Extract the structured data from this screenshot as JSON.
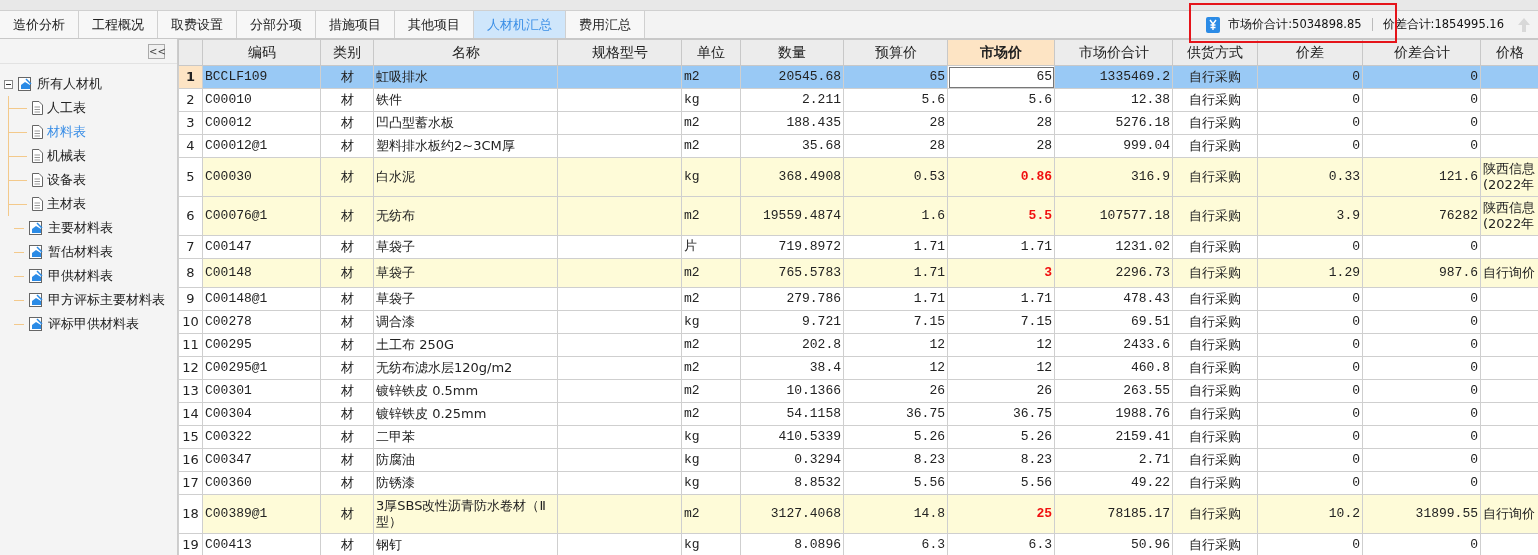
{
  "tabs": [
    {
      "label": "造价分析",
      "selected": false
    },
    {
      "label": "工程概况",
      "selected": false
    },
    {
      "label": "取费设置",
      "selected": false
    },
    {
      "label": "分部分项",
      "selected": false
    },
    {
      "label": "措施项目",
      "selected": false
    },
    {
      "label": "其他项目",
      "selected": false
    },
    {
      "label": "人材机汇总",
      "selected": true
    },
    {
      "label": "费用汇总",
      "selected": false
    }
  ],
  "summary": {
    "market_total": "市场价合计:5034898.85",
    "diff_total": "价差合计:1854995.16"
  },
  "sidebar": {
    "collapse_label": "<<",
    "items": [
      {
        "label": "所有人材机",
        "kind": "group",
        "expanded": true,
        "selected": false,
        "children": [
          {
            "label": "人工表",
            "kind": "sheet",
            "selected": false
          },
          {
            "label": "材料表",
            "kind": "sheet",
            "selected": true
          },
          {
            "label": "机械表",
            "kind": "sheet",
            "selected": false
          },
          {
            "label": "设备表",
            "kind": "sheet",
            "selected": false
          },
          {
            "label": "主材表",
            "kind": "sheet",
            "selected": false
          }
        ]
      },
      {
        "label": "主要材料表",
        "kind": "report",
        "selected": false
      },
      {
        "label": "暂估材料表",
        "kind": "report",
        "selected": false
      },
      {
        "label": "甲供材料表",
        "kind": "report",
        "selected": false
      },
      {
        "label": "甲方评标主要材料表",
        "kind": "report",
        "selected": false
      },
      {
        "label": "评标甲供材料表",
        "kind": "report",
        "selected": false
      }
    ]
  },
  "table": {
    "columns": [
      {
        "highlighted": false
      },
      {
        "label": "编码",
        "highlighted": false
      },
      {
        "label": "类别",
        "highlighted": false
      },
      {
        "label": "名称",
        "highlighted": false
      },
      {
        "label": "规格型号",
        "highlighted": false
      },
      {
        "label": "单位",
        "highlighted": false
      },
      {
        "label": "数量",
        "highlighted": false
      },
      {
        "label": "预算价",
        "highlighted": false
      },
      {
        "label": "市场价",
        "highlighted": true
      },
      {
        "label": "市场价合计",
        "highlighted": false
      },
      {
        "label": "供货方式",
        "highlighted": false
      },
      {
        "label": "价差",
        "highlighted": false
      },
      {
        "label": "价差合计",
        "highlighted": false
      },
      {
        "label": "价格",
        "highlighted": false
      }
    ],
    "rows": [
      {
        "no": "1",
        "code": "BCCLF109",
        "type": "材",
        "name": "虹吸排水",
        "unit": "m2",
        "qty": "20545.68",
        "budget": "65",
        "market": "65",
        "market_total": "1335469.2",
        "supply": "自行采购",
        "diff": "0",
        "diff_total": "0",
        "source": "",
        "selected": true,
        "changed": false
      },
      {
        "no": "2",
        "code": "C00010",
        "type": "材",
        "name": "铁件",
        "unit": "kg",
        "qty": "2.211",
        "budget": "5.6",
        "market": "5.6",
        "market_total": "12.38",
        "supply": "自行采购",
        "diff": "0",
        "diff_total": "0",
        "source": "",
        "selected": false,
        "changed": false
      },
      {
        "no": "3",
        "code": "C00012",
        "type": "材",
        "name": "凹凸型蓄水板",
        "unit": "m2",
        "qty": "188.435",
        "budget": "28",
        "market": "28",
        "market_total": "5276.18",
        "supply": "自行采购",
        "diff": "0",
        "diff_total": "0",
        "source": "",
        "selected": false,
        "changed": false
      },
      {
        "no": "4",
        "code": "C00012@1",
        "type": "材",
        "name": "塑料排水板约2~3CM厚",
        "unit": "m2",
        "qty": "35.68",
        "budget": "28",
        "market": "28",
        "market_total": "999.04",
        "supply": "自行采购",
        "diff": "0",
        "diff_total": "0",
        "source": "",
        "selected": false,
        "changed": false
      },
      {
        "no": "5",
        "code": "C00030",
        "type": "材",
        "name": "白水泥",
        "unit": "kg",
        "qty": "368.4908",
        "budget": "0.53",
        "market": "0.86",
        "market_total": "316.9",
        "supply": "自行采购",
        "diff": "0.33",
        "diff_total": "121.6",
        "source": "陕西信息\n(2022年",
        "selected": false,
        "changed": true
      },
      {
        "no": "6",
        "code": "C00076@1",
        "type": "材",
        "name": "无纺布",
        "unit": "m2",
        "qty": "19559.4874",
        "budget": "1.6",
        "market": "5.5",
        "market_total": "107577.18",
        "supply": "自行采购",
        "diff": "3.9",
        "diff_total": "76282",
        "source": "陕西信息\n(2022年",
        "selected": false,
        "changed": true
      },
      {
        "no": "7",
        "code": "C00147",
        "type": "材",
        "name": "草袋子",
        "unit": "片",
        "qty": "719.8972",
        "budget": "1.71",
        "market": "1.71",
        "market_total": "1231.02",
        "supply": "自行采购",
        "diff": "0",
        "diff_total": "0",
        "source": "",
        "selected": false,
        "changed": false
      },
      {
        "no": "8",
        "code": "C00148",
        "type": "材",
        "name": "草袋子",
        "unit": "m2",
        "qty": "765.5783",
        "budget": "1.71",
        "market": "3",
        "market_total": "2296.73",
        "supply": "自行采购",
        "diff": "1.29",
        "diff_total": "987.6",
        "source": "自行询价",
        "selected": false,
        "changed": true
      },
      {
        "no": "9",
        "code": "C00148@1",
        "type": "材",
        "name": "草袋子",
        "unit": "m2",
        "qty": "279.786",
        "budget": "1.71",
        "market": "1.71",
        "market_total": "478.43",
        "supply": "自行采购",
        "diff": "0",
        "diff_total": "0",
        "source": "",
        "selected": false,
        "changed": false
      },
      {
        "no": "10",
        "code": "C00278",
        "type": "材",
        "name": "调合漆",
        "unit": "kg",
        "qty": "9.721",
        "budget": "7.15",
        "market": "7.15",
        "market_total": "69.51",
        "supply": "自行采购",
        "diff": "0",
        "diff_total": "0",
        "source": "",
        "selected": false,
        "changed": false
      },
      {
        "no": "11",
        "code": "C00295",
        "type": "材",
        "name": "土工布 250G",
        "unit": "m2",
        "qty": "202.8",
        "budget": "12",
        "market": "12",
        "market_total": "2433.6",
        "supply": "自行采购",
        "diff": "0",
        "diff_total": "0",
        "source": "",
        "selected": false,
        "changed": false
      },
      {
        "no": "12",
        "code": "C00295@1",
        "type": "材",
        "name": "无纺布滤水层120g/m2",
        "unit": "m2",
        "qty": "38.4",
        "budget": "12",
        "market": "12",
        "market_total": "460.8",
        "supply": "自行采购",
        "diff": "0",
        "diff_total": "0",
        "source": "",
        "selected": false,
        "changed": false
      },
      {
        "no": "13",
        "code": "C00301",
        "type": "材",
        "name": "镀锌铁皮 0.5mm",
        "unit": "m2",
        "qty": "10.1366",
        "budget": "26",
        "market": "26",
        "market_total": "263.55",
        "supply": "自行采购",
        "diff": "0",
        "diff_total": "0",
        "source": "",
        "selected": false,
        "changed": false
      },
      {
        "no": "14",
        "code": "C00304",
        "type": "材",
        "name": "镀锌铁皮 0.25mm",
        "unit": "m2",
        "qty": "54.1158",
        "budget": "36.75",
        "market": "36.75",
        "market_total": "1988.76",
        "supply": "自行采购",
        "diff": "0",
        "diff_total": "0",
        "source": "",
        "selected": false,
        "changed": false
      },
      {
        "no": "15",
        "code": "C00322",
        "type": "材",
        "name": "二甲苯",
        "unit": "kg",
        "qty": "410.5339",
        "budget": "5.26",
        "market": "5.26",
        "market_total": "2159.41",
        "supply": "自行采购",
        "diff": "0",
        "diff_total": "0",
        "source": "",
        "selected": false,
        "changed": false
      },
      {
        "no": "16",
        "code": "C00347",
        "type": "材",
        "name": "防腐油",
        "unit": "kg",
        "qty": "0.3294",
        "budget": "8.23",
        "market": "8.23",
        "market_total": "2.71",
        "supply": "自行采购",
        "diff": "0",
        "diff_total": "0",
        "source": "",
        "selected": false,
        "changed": false
      },
      {
        "no": "17",
        "code": "C00360",
        "type": "材",
        "name": "防锈漆",
        "unit": "kg",
        "qty": "8.8532",
        "budget": "5.56",
        "market": "5.56",
        "market_total": "49.22",
        "supply": "自行采购",
        "diff": "0",
        "diff_total": "0",
        "source": "",
        "selected": false,
        "changed": false
      },
      {
        "no": "18",
        "code": "C00389@1",
        "type": "材",
        "name": "3厚SBS改性沥青防水卷材（Ⅱ型）",
        "unit": "m2",
        "qty": "3127.4068",
        "budget": "14.8",
        "market": "25",
        "market_total": "78185.17",
        "supply": "自行采购",
        "diff": "10.2",
        "diff_total": "31899.55",
        "source": "自行询价",
        "selected": false,
        "changed": true
      },
      {
        "no": "19",
        "code": "C00413",
        "type": "材",
        "name": "钢钉",
        "unit": "kg",
        "qty": "8.0896",
        "budget": "6.3",
        "market": "6.3",
        "market_total": "50.96",
        "supply": "自行采购",
        "diff": "0",
        "diff_total": "0",
        "source": "",
        "selected": false,
        "changed": false
      }
    ]
  }
}
